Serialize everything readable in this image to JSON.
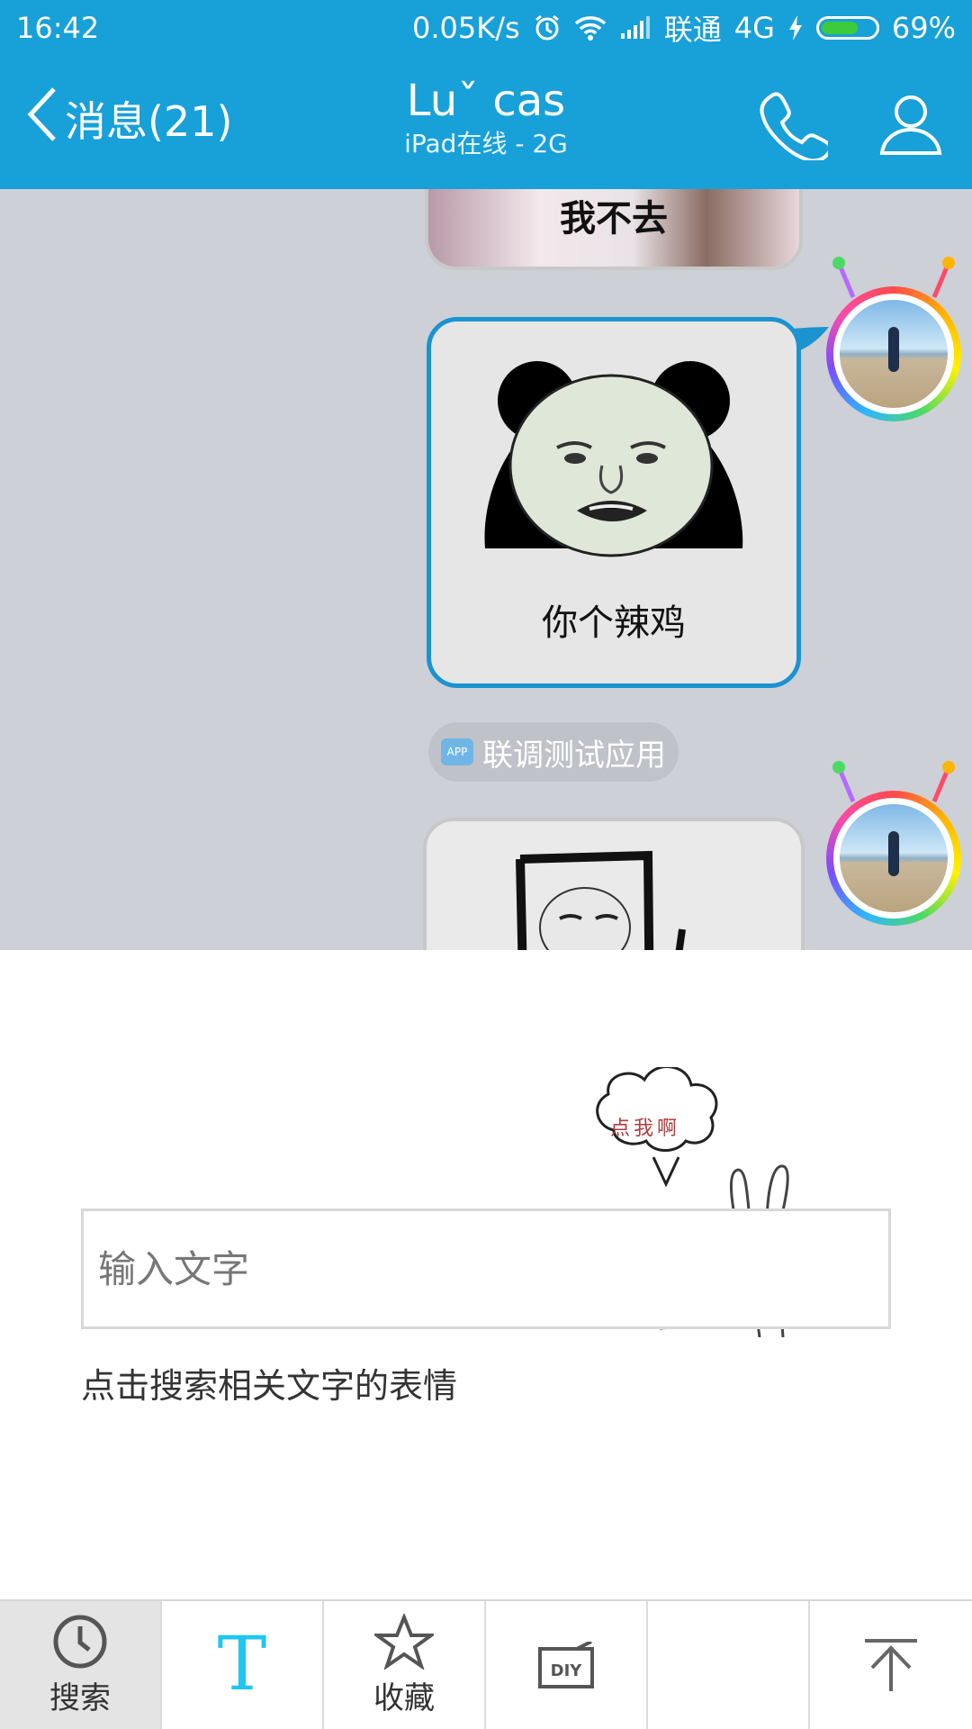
{
  "status_bar": {
    "time": "16:42",
    "net_speed": "0.05K/s",
    "carrier": "联通",
    "network": "4G",
    "battery_percent": "69%",
    "battery_level": 0.69,
    "icons": [
      "alarm-icon",
      "wifi-icon",
      "signal-icon",
      "charging-icon",
      "battery-icon"
    ]
  },
  "header": {
    "back_label": "消息(21)",
    "contact_name": "Luˇ cas",
    "contact_status": "iPad在线 - 2G",
    "icons": [
      "back-chevron-icon",
      "phone-icon",
      "profile-icon"
    ]
  },
  "chat": {
    "messages": [
      {
        "type": "sticker",
        "caption": "我不去"
      },
      {
        "type": "sticker",
        "caption": "你个辣鸡"
      },
      {
        "type": "sticker",
        "caption": ""
      }
    ],
    "app_tag": {
      "icon_text": "APP",
      "label": "联调测试应用"
    }
  },
  "sticker_search": {
    "placeholder": "输入文字",
    "value": "",
    "hint": "点击搜索相关文字的表情",
    "mascot_bubble": "点我啊"
  },
  "bottom_tabs": [
    {
      "label": "搜索",
      "icon": "clock-icon",
      "active": true
    },
    {
      "label": "",
      "icon": "text-t-icon",
      "active": false
    },
    {
      "label": "收藏",
      "icon": "star-icon",
      "active": false
    },
    {
      "label": "",
      "icon": "diy-icon",
      "active": false
    },
    {
      "label": "",
      "icon": "",
      "active": false
    },
    {
      "label": "",
      "icon": "collapse-up-icon",
      "active": false
    }
  ],
  "colors": {
    "header_blue": "#18a0d8",
    "chat_bg": "#cdd0d6",
    "bubble_border_blue": "#1a93d0",
    "t_icon_cyan": "#1ec6f2"
  }
}
